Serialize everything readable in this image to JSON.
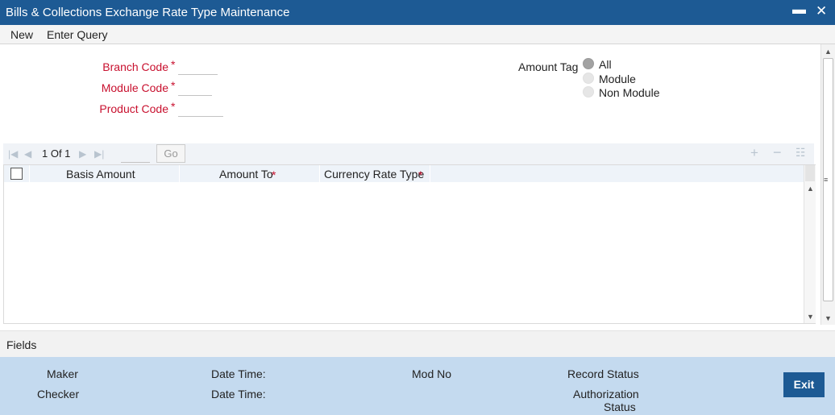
{
  "window": {
    "title": "Bills & Collections Exchange Rate Type Maintenance",
    "minimize": "▬",
    "close": "✕"
  },
  "menu": {
    "new_label": "New",
    "enter_query_label": "Enter Query"
  },
  "form": {
    "branch_code_label": "Branch Code",
    "module_code_label": "Module Code",
    "product_code_label": "Product Code",
    "required_mark": "*",
    "branch_code_value": "",
    "module_code_value": "",
    "product_code_value": "",
    "amount_tag_label": "Amount Tag",
    "amount_tag_options": [
      "All",
      "Module",
      "Non Module"
    ],
    "amount_tag_selected": "All"
  },
  "grid": {
    "page_text": "1 Of 1",
    "page_input_value": "",
    "go_label": "Go",
    "columns": [
      "Basis Amount",
      "Amount To",
      "Currency Rate Type"
    ],
    "required_mark": "*",
    "rows": []
  },
  "fields_bar": {
    "label": "Fields"
  },
  "footer": {
    "maker_label": "Maker",
    "checker_label": "Checker",
    "date_time_label": "Date Time:",
    "mod_no_label": "Mod No",
    "record_status_label": "Record Status",
    "authorization_label": "Authorization",
    "status_label": "Status",
    "exit_label": "Exit"
  },
  "colors": {
    "title_bar": "#1d5a94",
    "required_label": "#c8102e",
    "footer_bg": "#c4daef",
    "exit_button": "#1d5a94"
  }
}
